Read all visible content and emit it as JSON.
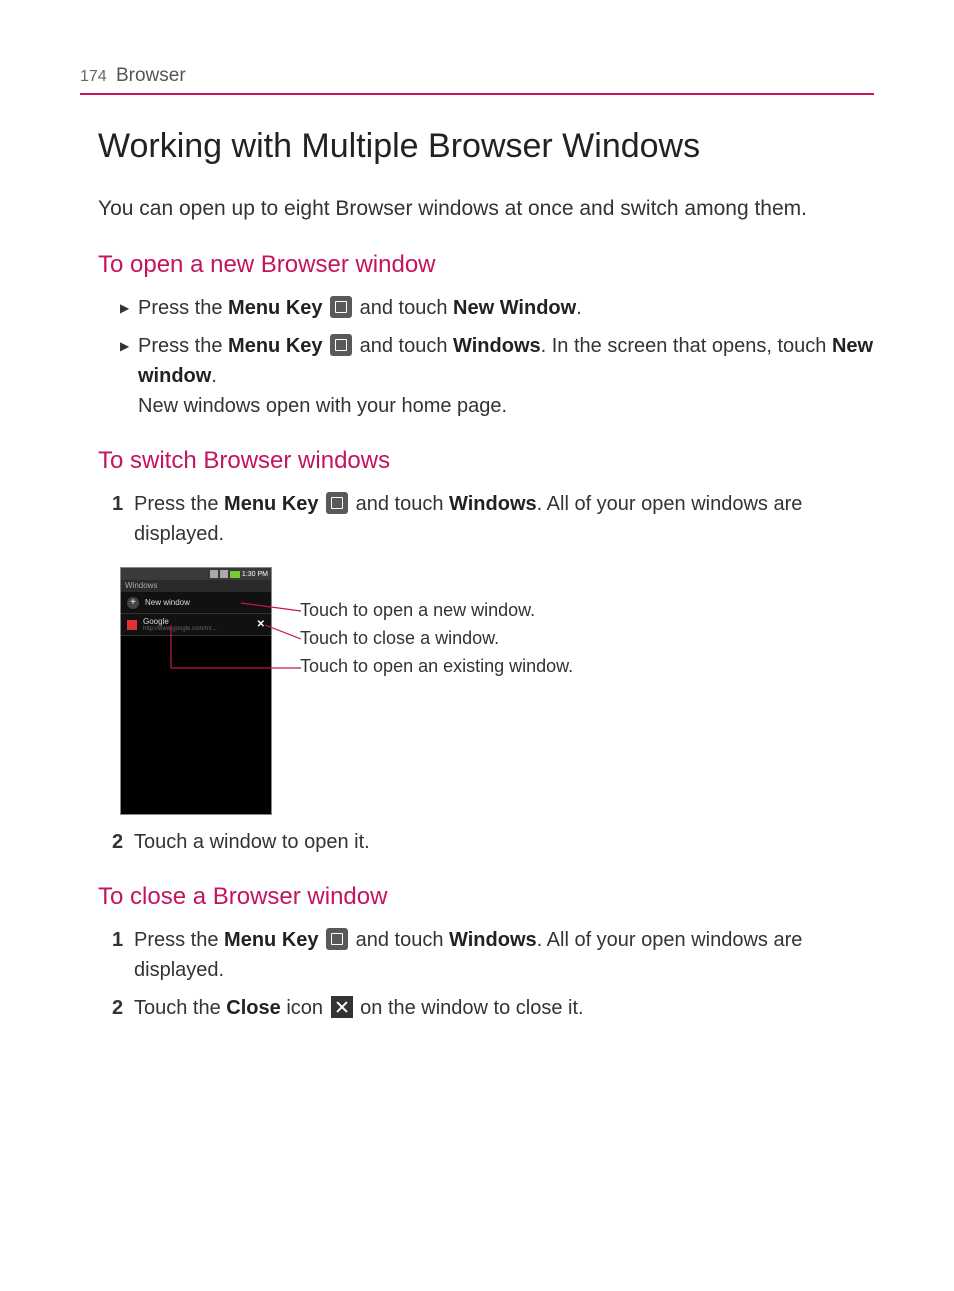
{
  "header": {
    "page_number": "174",
    "section": "Browser"
  },
  "title": "Working with Multiple Browser Windows",
  "intro": "You can open up to eight Browser windows at once and switch among them.",
  "sections": {
    "open": {
      "heading": "To open a new Browser window",
      "b1_p1": "Press the ",
      "b1_menukey": "Menu Key",
      "b1_p2": " and touch ",
      "b1_newwindow": "New Window",
      "b1_p3": ".",
      "b2_p1": "Press the ",
      "b2_menukey": "Menu Key",
      "b2_p2": " and touch ",
      "b2_windows": "Windows",
      "b2_p3": ". In the screen that opens, touch ",
      "b2_newwindow": "New window",
      "b2_p4": ".",
      "b2_line2": "New windows open with your home page."
    },
    "switch": {
      "heading": "To switch Browser windows",
      "s1_p1": "Press the ",
      "s1_menukey": "Menu Key",
      "s1_p2": " and touch ",
      "s1_windows": "Windows",
      "s1_p3": ".",
      "s1_line2": "All of your open windows are displayed.",
      "s2": "Touch a window to open it."
    },
    "close": {
      "heading": "To close a Browser window",
      "c1_p1": "Press the ",
      "c1_menukey": "Menu Key",
      "c1_p2": " and touch ",
      "c1_windows": "Windows",
      "c1_p3": ".",
      "c1_line2": "All of your open windows are displayed.",
      "c2_p1": "Touch the ",
      "c2_close": "Close",
      "c2_p2": " icon ",
      "c2_p3": " on the window to close it."
    }
  },
  "figure": {
    "time": "1:30 PM",
    "title": "Windows",
    "new_window": "New window",
    "tab_title": "Google",
    "tab_url": "http://www.google.com/m/...",
    "callout1": "Touch to open a new window.",
    "callout2": "Touch to close a window.",
    "callout3": "Touch to open an existing window."
  },
  "markers": {
    "num1": "1",
    "num2": "2"
  }
}
